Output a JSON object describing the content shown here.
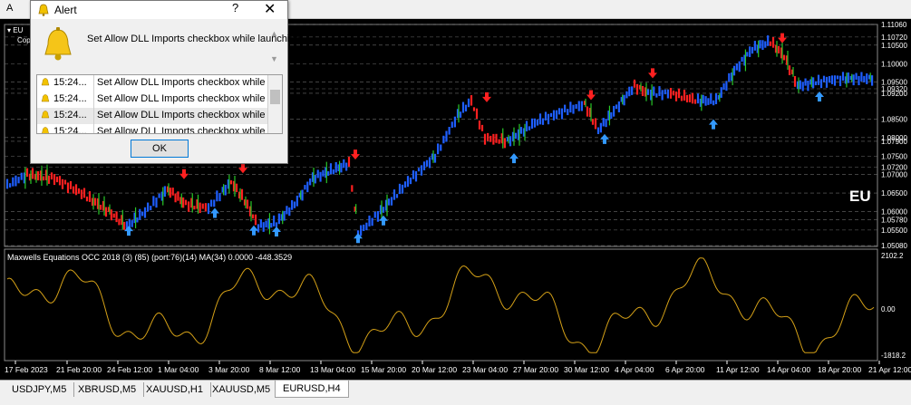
{
  "topbar": {
    "menu_letter": "A",
    "chart_symbol": "EU",
    "chart_copy": "Cop"
  },
  "dialog": {
    "title": "Alert",
    "help": "?",
    "message": "Set Allow DLL Imports checkbox while launching",
    "rows": [
      {
        "time": "15:24...",
        "text": "Set Allow DLL Imports checkbox while lau..."
      },
      {
        "time": "15:24...",
        "text": "Set Allow DLL Imports checkbox while lau..."
      },
      {
        "time": "15:24...",
        "text": "Set Allow DLL Imports checkbox while lau..."
      },
      {
        "time": "15:24...",
        "text": "Set Allow DLL Imports checkbox while lau..."
      }
    ],
    "ok_label": "OK"
  },
  "main_chart": {
    "symbol_watermark": "EU",
    "price_labels": [
      "1.11060",
      "1.10720",
      "1.10500",
      "1.10000",
      "1.09500",
      "1.09320",
      "1.09200",
      "1.08500",
      "1.08000",
      "1.07900",
      "1.07500",
      "1.07200",
      "1.07000",
      "1.06500",
      "1.06000",
      "1.05780",
      "1.05500",
      "1.05080"
    ]
  },
  "indicator": {
    "label": "Maxwells Equations OCC 2018 (3) (85) (port:76)(14) MA(34) 0.0000 -448.3529",
    "scale": [
      "2102.2",
      "0.00",
      "-1818.2"
    ]
  },
  "time_axis": [
    "17 Feb 2023",
    "21 Feb 20:00",
    "24 Feb 12:00",
    "1 Mar 04:00",
    "3 Mar 20:00",
    "8 Mar 12:00",
    "13 Mar 04:00",
    "15 Mar 20:00",
    "20 Mar 12:00",
    "23 Mar 04:00",
    "27 Mar 20:00",
    "30 Mar 12:00",
    "4 Apr 04:00",
    "6 Apr 20:00",
    "11 Apr 12:00",
    "14 Apr 04:00",
    "18 Apr 20:00",
    "21 Apr 12:00"
  ],
  "tabs": [
    {
      "label": "USDJPY,M5",
      "active": false
    },
    {
      "label": "XBRUSD,M5",
      "active": false
    },
    {
      "label": "XAUUSD,H1",
      "active": false
    },
    {
      "label": "XAUUSD,M5",
      "active": false
    },
    {
      "label": "EURUSD,H4",
      "active": true
    }
  ],
  "colors": {
    "background": "#000000",
    "up": "#1e5eff",
    "down": "#ff2020",
    "indicator_line": "#d4a017",
    "up_arrow": "#3399ff",
    "down_arrow": "#ff2020"
  }
}
